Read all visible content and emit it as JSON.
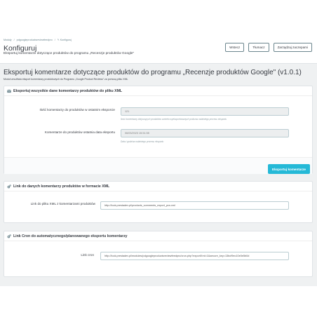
{
  "breadcrumb": [
    "Moduły",
    "/",
    "pdgoogleproductsreviewfeedpro",
    "/",
    "✎ Konfiguruj"
  ],
  "header": {
    "title": "Konfiguruj",
    "subtitle": "Eksportuj komentarze dotyczące produktów do programu „Recenzje produktów Google\""
  },
  "toolbar": {
    "back_label": "Wstecz",
    "translate_label": "Tłumacz",
    "manage_hooks_label": "Zarządzaj zaczepami"
  },
  "module": {
    "title": "Eksportuj komentarze dotyczące produktów do programu „Recenzje produktów Google\" (v1.0.1)",
    "note": "Moduł umożliwia eksport komentarzy produktowych do Programu „Google Product Reviews\" za pomocą pliku XML"
  },
  "export_panel": {
    "heading": "Eksportuj wszystkie dane komentarzy produktów do pliku XML",
    "count_label": "Ilość komentarzy do produktów w ostatnim eksporcie",
    "count_value": "121",
    "count_help": "Ilość komentarzy dotyczących produktów szeżeło wyeksportowanych podczas ostatniego procesu eksportu",
    "date_label": "Komentarze do produktów ostatnia data eksportu",
    "date_value": "06/03/2023 15:51:55",
    "date_help": "Data i godzina ostatniego procesu eksportu",
    "export_button": "Eksportuj komentarze"
  },
  "link_panel": {
    "heading": "Link do danych komentarzy produktów w formacie XML",
    "label": "Link do pliku XML z komentarzami produktów",
    "value": "http://look.prestadev.pl/products_comments_export_pcs.xml"
  },
  "cron_panel": {
    "heading": "Link Cron do automatycznego/planowanego eksportu komentarzy",
    "label": "Link cron ",
    "value": "http://look.prestadev.pl/modules/pdgoogleproductsreviewfeedpro/cron.php?exportXml=1&secure_key=13bcf9ec10e0e5b0d"
  },
  "colors": {
    "accent": "#25b9d7",
    "background": "#eff1f2",
    "text": "#363a41"
  },
  "icons": {
    "export_panel": "envelope-icon",
    "link_panel": "cogs-icon",
    "cron_panel": "cogs-icon"
  }
}
